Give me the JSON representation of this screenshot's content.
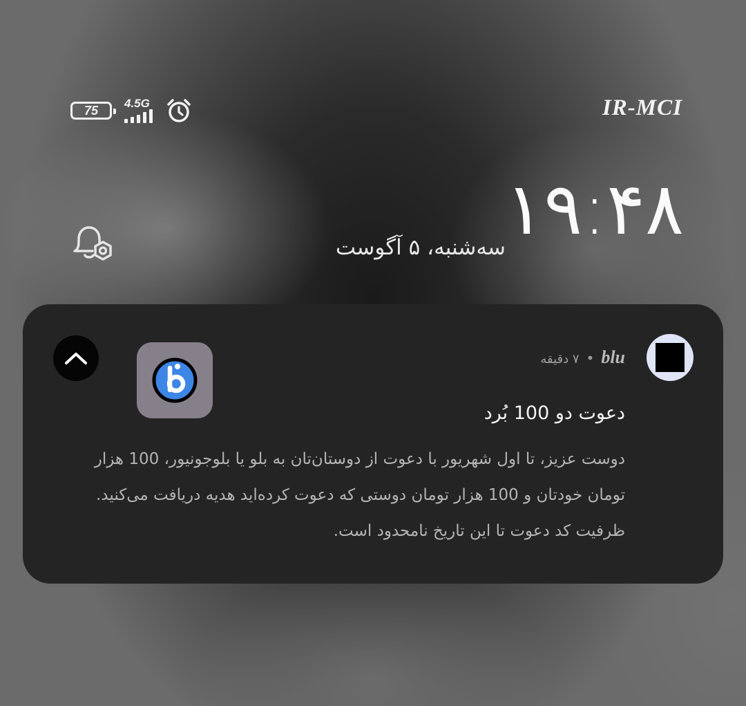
{
  "status_bar": {
    "battery_level": "75",
    "network_type": "4.5G",
    "carrier": "IR-MCI",
    "signal_icon": "signal-bars-icon",
    "alarm_icon": "alarm-clock-icon"
  },
  "lockscreen": {
    "time": "۱۹:۴۸",
    "date": "سه‌شنبه، ۵ آگوست",
    "dnd_icon": "notification-settings-icon"
  },
  "notification": {
    "app_name": "blu",
    "separator": "•",
    "time_ago": "۷ دقیقه",
    "title": "دعوت دو 100 بُرد",
    "body": "دوست عزیز، تا اول شهریور با دعوت از دوستان‌تان به بلو یا بلوجونیور، 100 هزار تومان خودتان و 100 هزار تومان دوستی که دعوت کرده‌اید هدیه دریافت می‌کنید. ظرفیت کد دعوت تا این تاریخ نامحدود است.",
    "collapse_icon": "chevron-up-icon",
    "logo_icon": "blu-logo-icon"
  },
  "colors": {
    "card_bg": "#242424",
    "logo_blue": "#3d86e6",
    "logo_tile": "#86808a"
  }
}
